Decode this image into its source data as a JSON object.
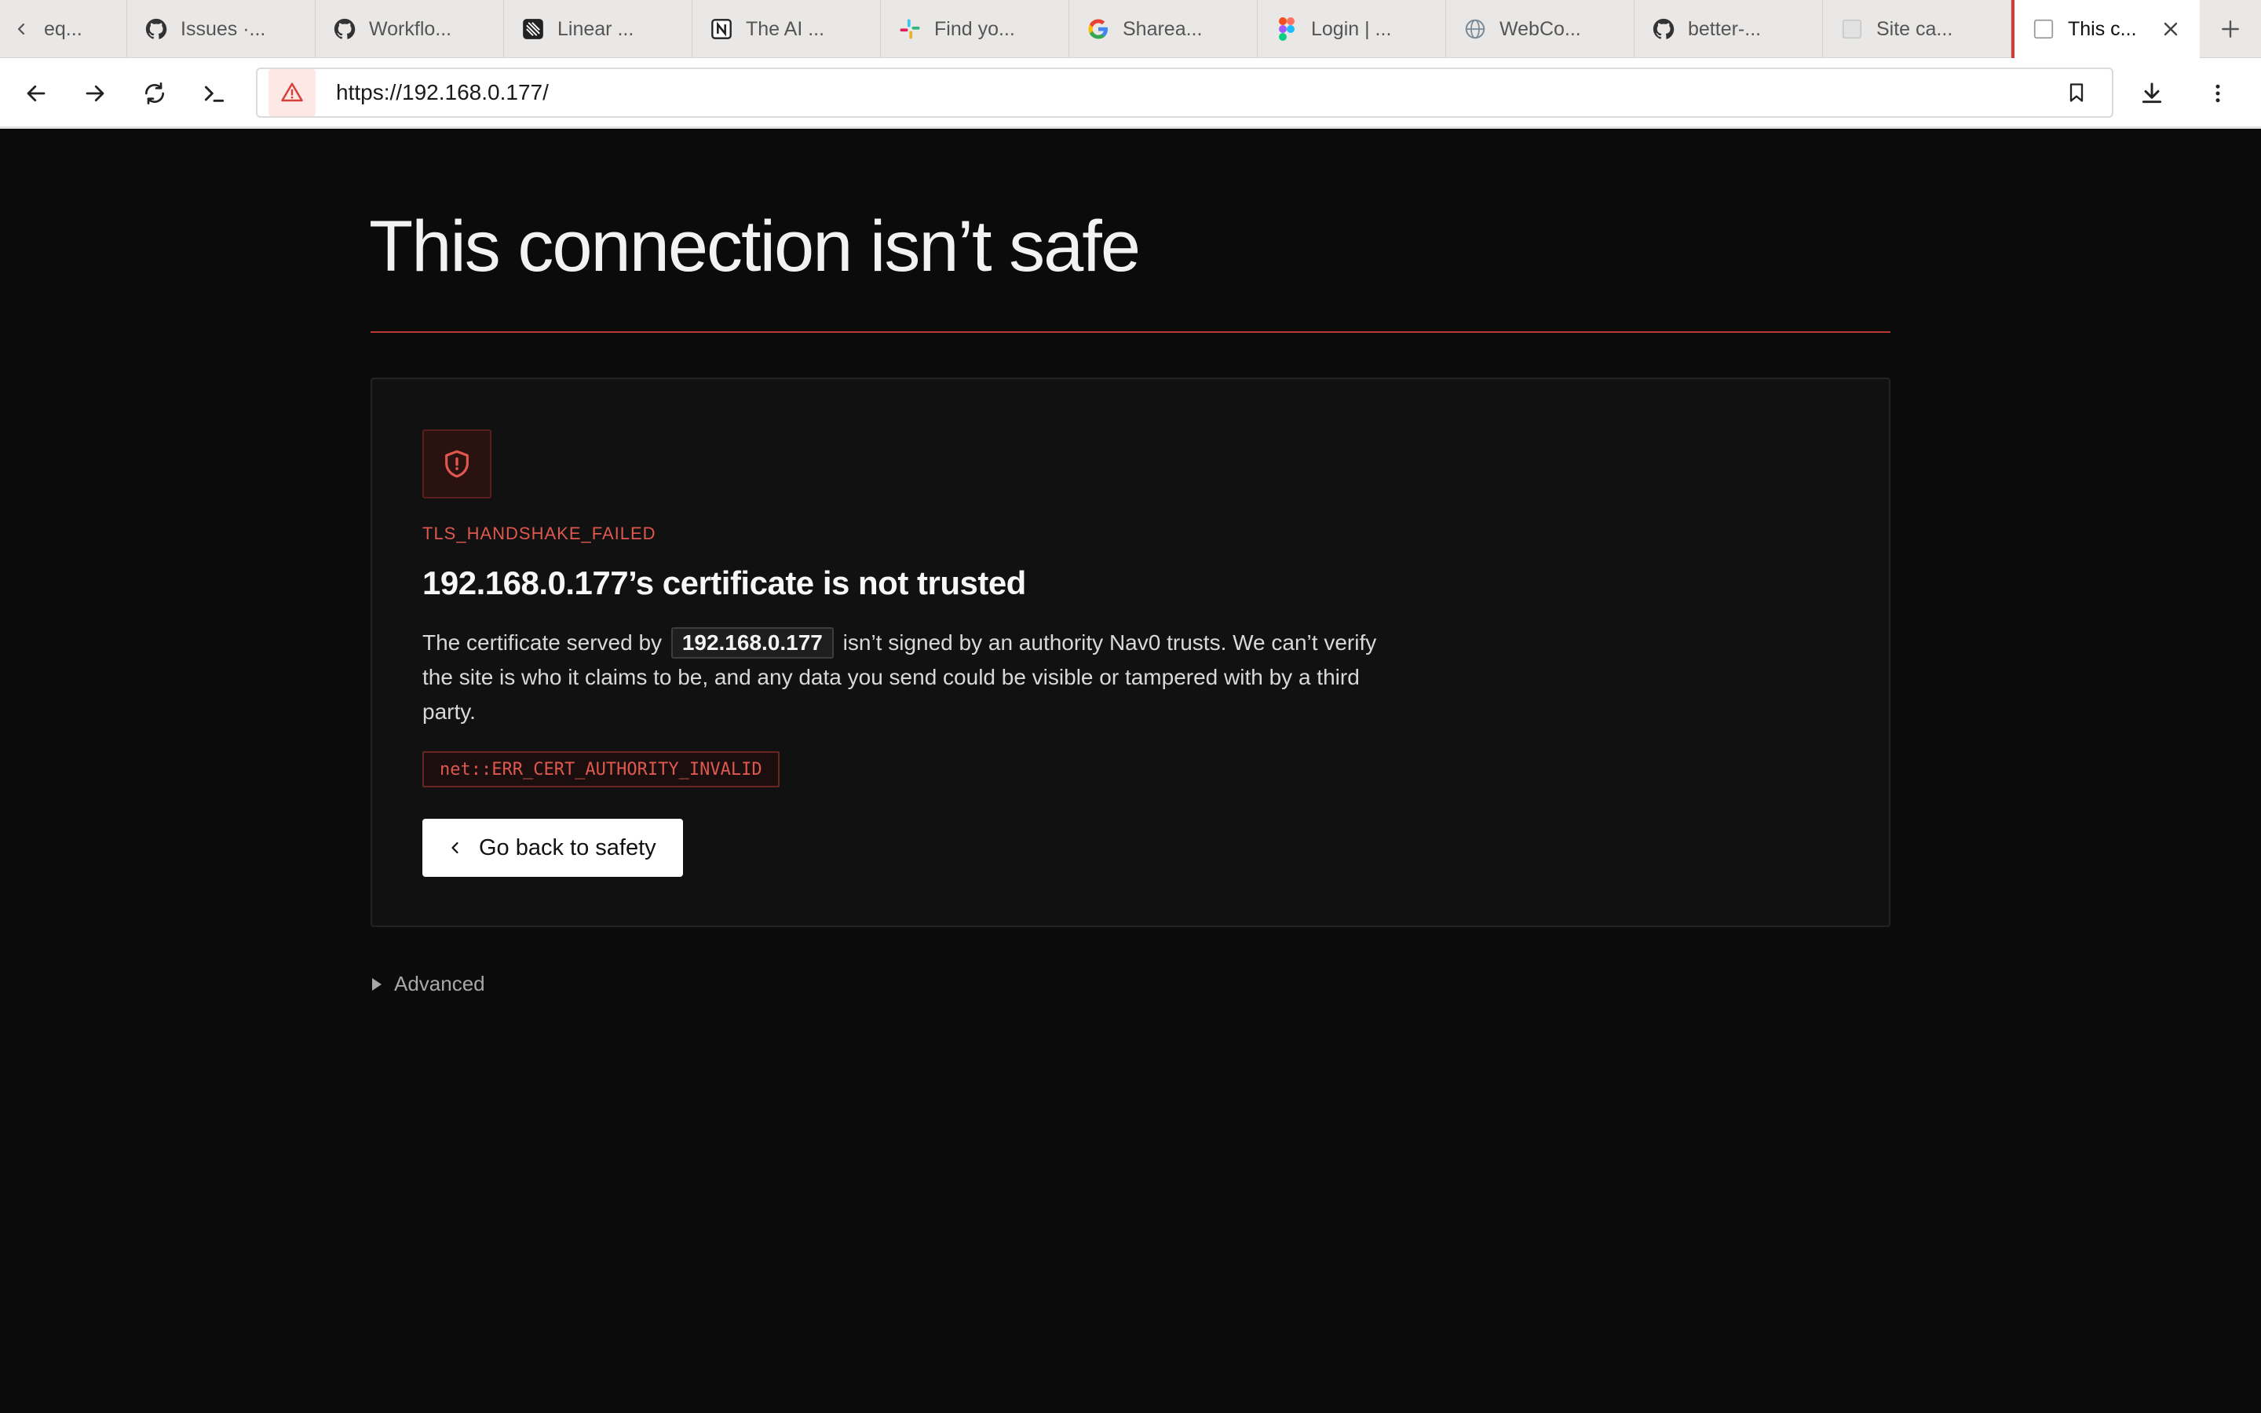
{
  "tabs": [
    {
      "title": "eq...",
      "icon": "blank-icon"
    },
    {
      "title": "Issues ·...",
      "icon": "github-icon"
    },
    {
      "title": "Workflo...",
      "icon": "github-icon"
    },
    {
      "title": "Linear ...",
      "icon": "linear-icon"
    },
    {
      "title": "The AI ...",
      "icon": "notion-icon"
    },
    {
      "title": "Find yo...",
      "icon": "slack-icon"
    },
    {
      "title": "Sharea...",
      "icon": "google-icon"
    },
    {
      "title": "Login | ...",
      "icon": "figma-icon"
    },
    {
      "title": "WebCo...",
      "icon": "webco-icon"
    },
    {
      "title": "better-...",
      "icon": "github-icon"
    },
    {
      "title": "Site ca...",
      "icon": "blank-page-icon"
    },
    {
      "title": "This c...",
      "icon": "blank-page-icon",
      "active": true
    }
  ],
  "address": {
    "url": "https://192.168.0.177/"
  },
  "page": {
    "title": "This connection isn’t safe",
    "error_code": "TLS_HANDSHAKE_FAILED",
    "heading": "192.168.0.177’s certificate is not trusted",
    "body_pre": "The certificate served by",
    "body_host": "192.168.0.177",
    "body_post": "isn’t signed by an authority Nav0 trusts. We can’t verify the site is who it claims to be, and any data you send could be visible or tampered with by a third party.",
    "net_error": "net::ERR_CERT_AUTHORITY_INVALID",
    "back_label": "Go back to safety",
    "advanced_label": "Advanced"
  },
  "colors": {
    "accent_red": "#e0574d",
    "rule_red": "#b73a34",
    "page_bg": "#0b0b0b",
    "card_bg": "#111111"
  }
}
